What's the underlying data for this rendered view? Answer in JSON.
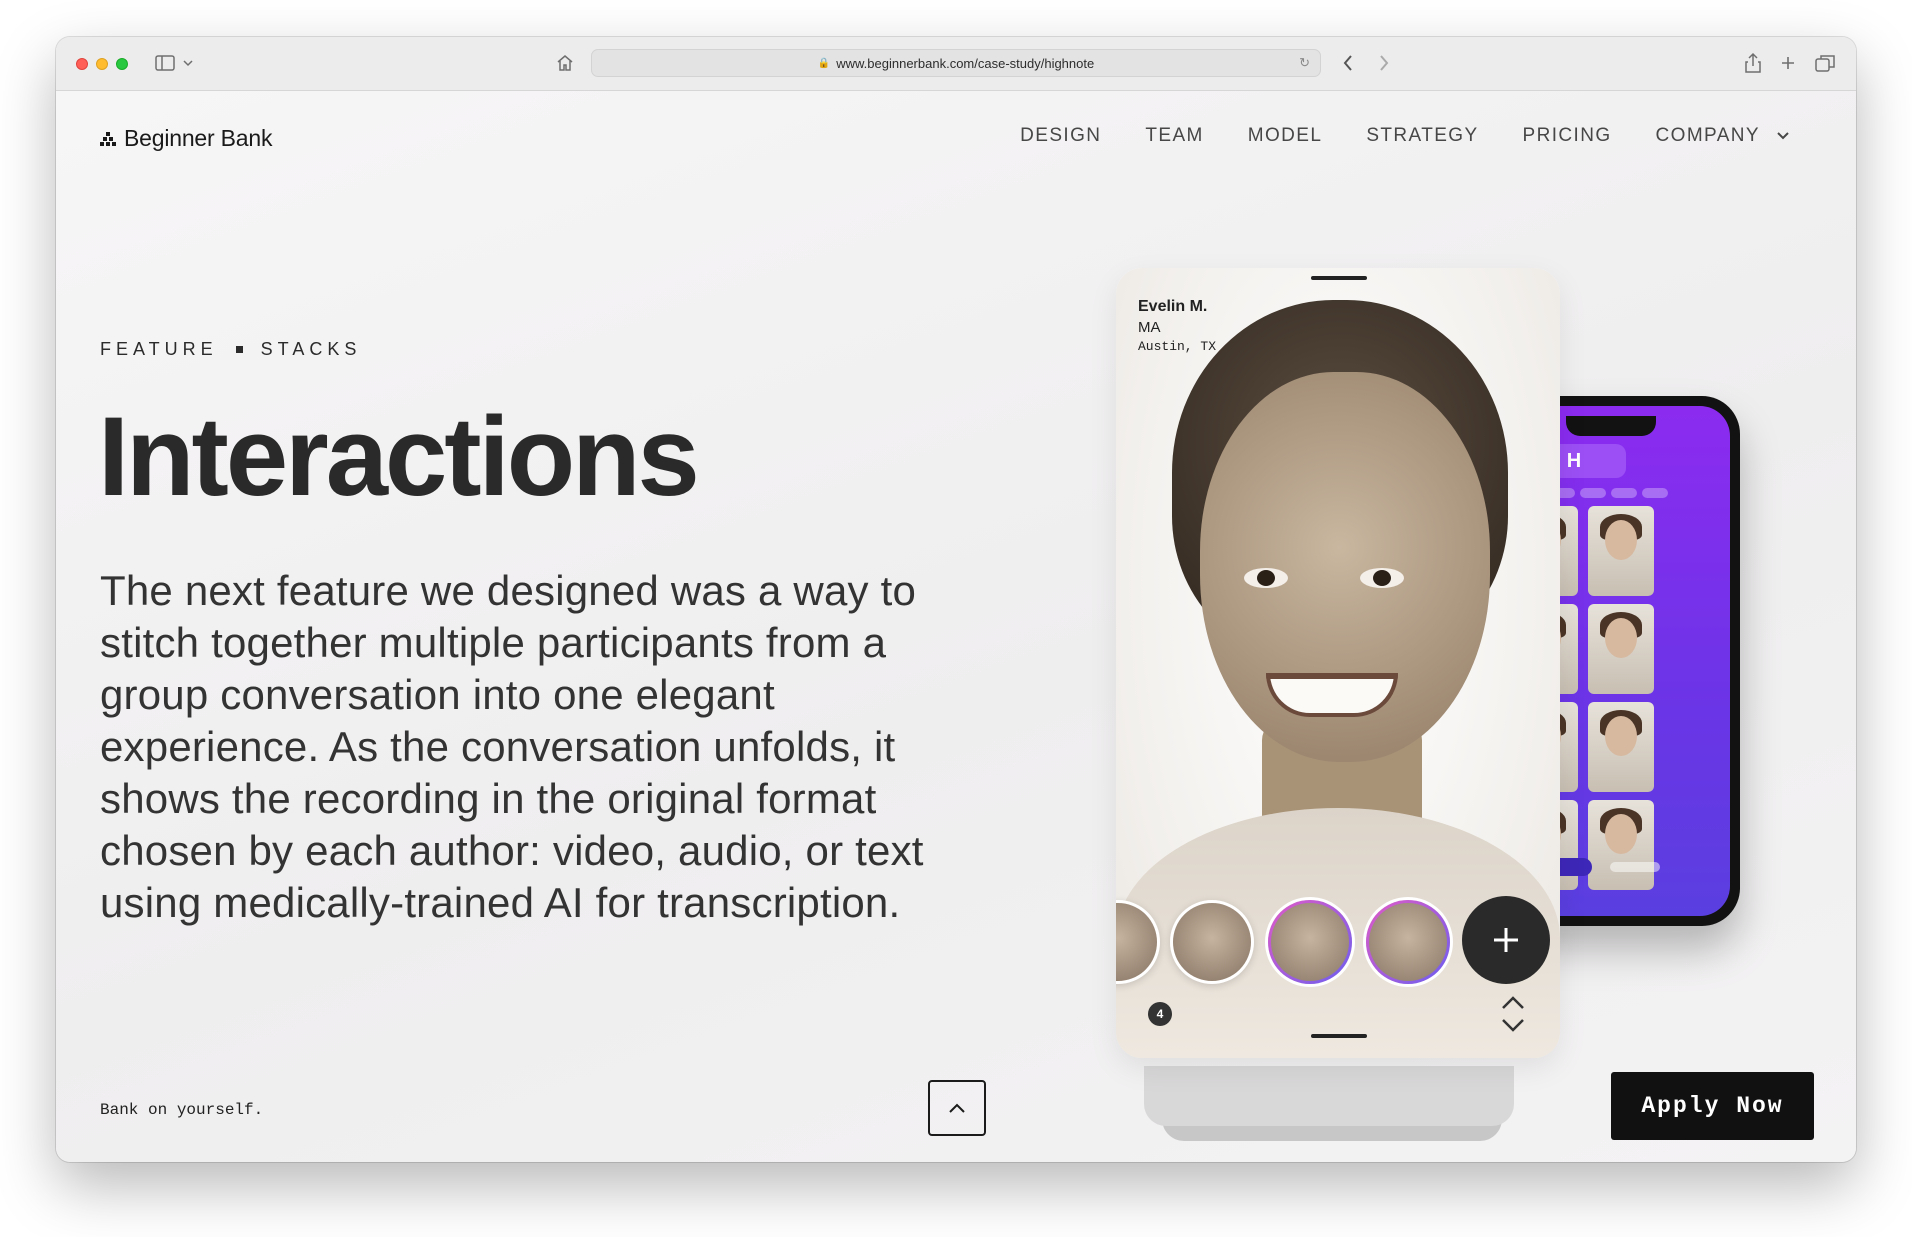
{
  "browser": {
    "url": "www.beginnerbank.com/case-study/highnote"
  },
  "header": {
    "brand": "Beginner Bank",
    "nav": [
      {
        "label": "DESIGN"
      },
      {
        "label": "TEAM"
      },
      {
        "label": "MODEL"
      },
      {
        "label": "STRATEGY"
      },
      {
        "label": "PRICING"
      },
      {
        "label": "COMPANY"
      }
    ]
  },
  "hero": {
    "eyebrow_left": "FEATURE",
    "eyebrow_right": "STACKS",
    "title": "Interactions",
    "body": "The next feature we designed was a way to stitch together multiple participants from a group conversation into one elegant experience. As the conversation unfolds, it shows the recording in the original format chosen by each author: video, audio, or text using medically-trained AI for transcription."
  },
  "phone": {
    "caller_name": "Evelin M.",
    "caller_degree": "MA",
    "caller_location": "Austin, TX",
    "count_badge": "4"
  },
  "footer": {
    "tagline": "Bank on yourself.",
    "apply_label": "Apply Now"
  },
  "colors": {
    "accent_purple": "#7b2ff0",
    "button_dark": "#111111",
    "page_bg": "#f1f0f1"
  }
}
